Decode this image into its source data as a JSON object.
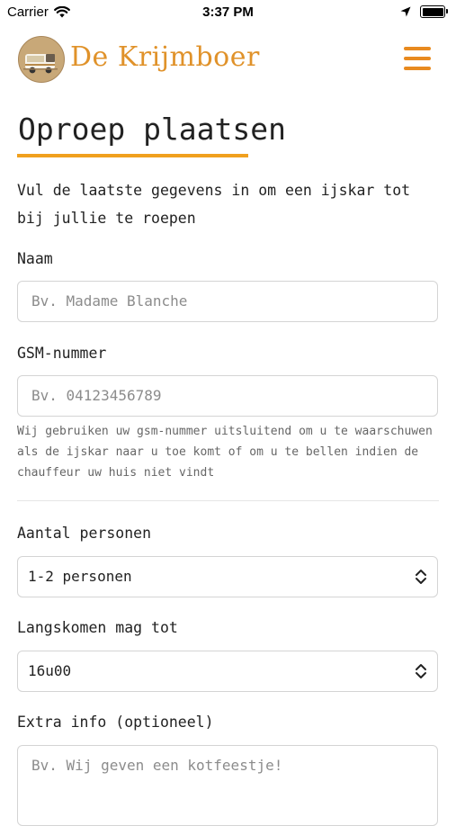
{
  "status_bar": {
    "carrier": "Carrier",
    "time": "3:37 PM"
  },
  "header": {
    "brand": "De Krijmboer"
  },
  "page": {
    "title": "Oproep plaatsen",
    "intro": "Vul de laatste gegevens in om een ijskar tot bij jullie te roepen"
  },
  "form": {
    "name": {
      "label": "Naam",
      "placeholder": "Bv. Madame Blanche"
    },
    "phone": {
      "label": "GSM-nummer",
      "placeholder": "Bv. 04123456789",
      "help": "Wij gebruiken uw gsm-nummer uitsluitend om u te waarschuwen als de ijskar naar u toe komt of om u te bellen indien de chauffeur uw huis niet vindt"
    },
    "persons": {
      "label": "Aantal personen",
      "value": "1-2 personen"
    },
    "until": {
      "label": "Langskomen mag tot",
      "value": "16u00"
    },
    "extra": {
      "label": "Extra info (optioneel)",
      "placeholder": "Bv. Wij geven een kotfeestje!"
    }
  },
  "colors": {
    "accent": "#e88a1f",
    "underline": "#f0a01e",
    "brand": "#e0922a"
  },
  "icons": [
    "wifi-icon",
    "location-arrow-icon",
    "battery-icon",
    "logo-truck-icon",
    "hamburger-menu-icon",
    "chevron-updown-icon"
  ]
}
